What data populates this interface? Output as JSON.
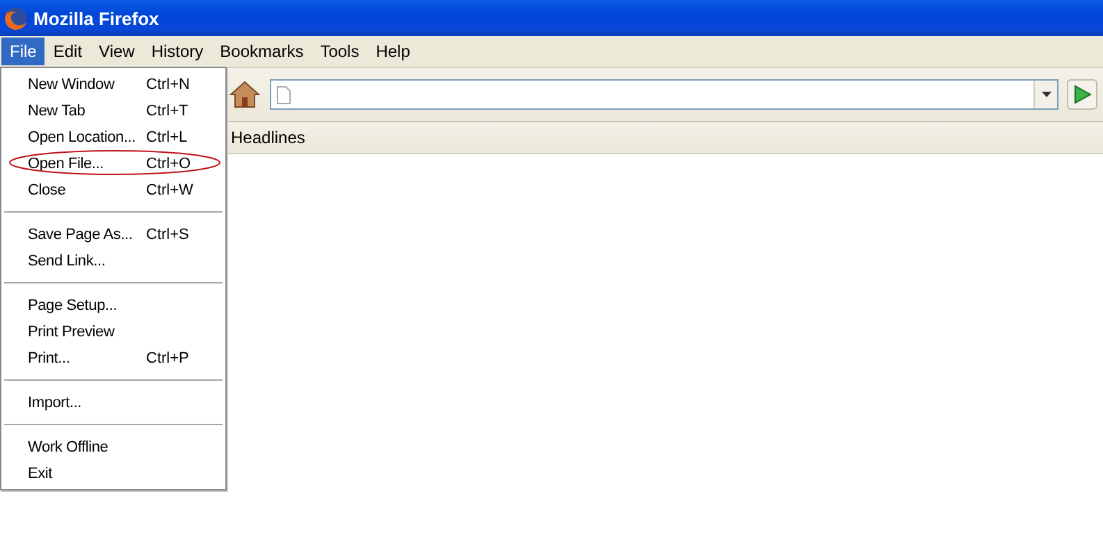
{
  "window": {
    "title": "Mozilla Firefox"
  },
  "menubar": [
    {
      "label": "File",
      "selected": true
    },
    {
      "label": "Edit",
      "selected": false
    },
    {
      "label": "View",
      "selected": false
    },
    {
      "label": "History",
      "selected": false
    },
    {
      "label": "Bookmarks",
      "selected": false
    },
    {
      "label": "Tools",
      "selected": false
    },
    {
      "label": "Help",
      "selected": false
    }
  ],
  "bookmarks_bar": [
    {
      "label": "Headlines"
    }
  ],
  "file_menu": [
    [
      {
        "label": "New Window",
        "shortcut": "Ctrl+N",
        "circled": false
      },
      {
        "label": "New Tab",
        "shortcut": "Ctrl+T",
        "circled": false
      },
      {
        "label": "Open Location...",
        "shortcut": "Ctrl+L",
        "circled": false
      },
      {
        "label": "Open File...",
        "shortcut": "Ctrl+O",
        "circled": true
      },
      {
        "label": "Close",
        "shortcut": "Ctrl+W",
        "circled": false
      }
    ],
    [
      {
        "label": "Save Page As...",
        "shortcut": "Ctrl+S",
        "circled": false
      },
      {
        "label": "Send Link...",
        "circled": false
      }
    ],
    [
      {
        "label": "Page Setup...",
        "circled": false
      },
      {
        "label": "Print Preview",
        "circled": false
      },
      {
        "label": "Print...",
        "shortcut": "Ctrl+P",
        "circled": false
      }
    ],
    [
      {
        "label": "Import...",
        "circled": false
      }
    ],
    [
      {
        "label": "Work Offline",
        "circled": false
      },
      {
        "label": "Exit",
        "circled": false
      }
    ]
  ]
}
